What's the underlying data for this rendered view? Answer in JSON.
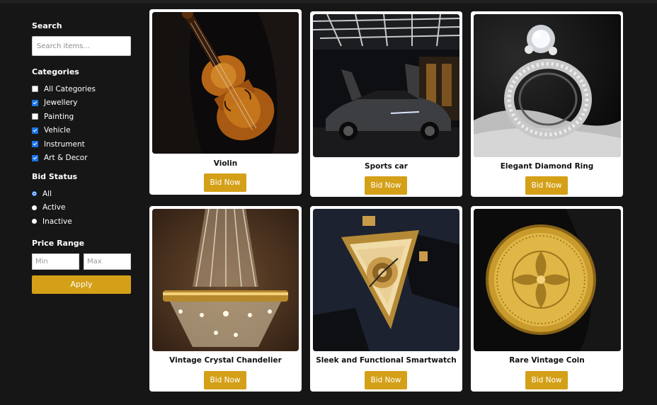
{
  "sidebar": {
    "search": {
      "title": "Search",
      "placeholder": "Search items..."
    },
    "categories": {
      "title": "Categories",
      "items": [
        {
          "label": "All Categories",
          "checked": false
        },
        {
          "label": "Jewellery",
          "checked": true
        },
        {
          "label": "Painting",
          "checked": false
        },
        {
          "label": "Vehicle",
          "checked": true
        },
        {
          "label": "Instrument",
          "checked": true
        },
        {
          "label": "Art & Decor",
          "checked": true
        }
      ]
    },
    "bid_status": {
      "title": "Bid Status",
      "options": [
        {
          "label": "All",
          "selected": true
        },
        {
          "label": "Active",
          "selected": false
        },
        {
          "label": "Inactive",
          "selected": false
        }
      ]
    },
    "price_range": {
      "title": "Price Range",
      "min_placeholder": "Min",
      "max_placeholder": "Max",
      "apply_label": "Apply"
    }
  },
  "items": [
    {
      "title": "Violin",
      "button": "Bid Now"
    },
    {
      "title": "Sports car",
      "button": "Bid Now"
    },
    {
      "title": "Elegant Diamond Ring",
      "button": "Bid Now"
    },
    {
      "title": "Vintage Crystal Chandelier",
      "button": "Bid Now"
    },
    {
      "title": "Sleek and Functional Smartwatch",
      "button": "Bid Now"
    },
    {
      "title": "Rare Vintage Coin",
      "button": "Bid Now"
    }
  ],
  "colors": {
    "accent": "#d4a018",
    "background": "#161616",
    "checkbox": "#1a73e8"
  }
}
